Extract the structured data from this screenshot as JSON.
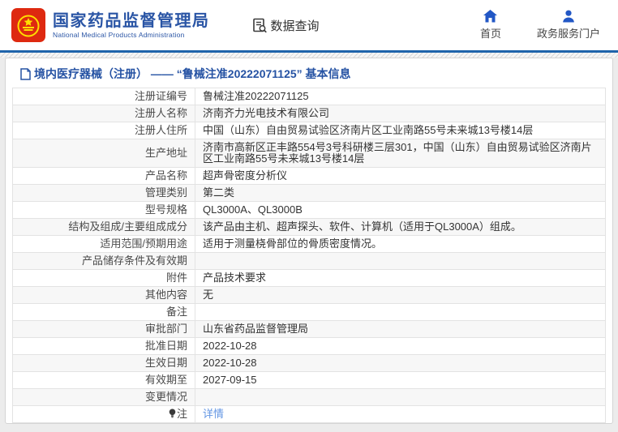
{
  "header": {
    "agency_name_cn": "国家药品监督管理局",
    "agency_name_en": "National Medical Products Administration",
    "data_query_label": "数据查询",
    "home_label": "首页",
    "portal_label": "政务服务门户"
  },
  "breadcrumb": {
    "text": "境内医疗器械（注册） —— “鲁械注准20222071125” 基本信息"
  },
  "table": {
    "rows": [
      {
        "label": "注册证编号",
        "value": "鲁械注准20222071125"
      },
      {
        "label": "注册人名称",
        "value": "济南齐力光电技术有限公司"
      },
      {
        "label": "注册人住所",
        "value": "中国（山东）自由贸易试验区济南片区工业南路55号未来城13号楼14层"
      },
      {
        "label": "生产地址",
        "value": "济南市高新区正丰路554号3号科研楼三层301，中国（山东）自由贸易试验区济南片区工业南路55号未来城13号楼14层"
      },
      {
        "label": "产品名称",
        "value": "超声骨密度分析仪"
      },
      {
        "label": "管理类别",
        "value": "第二类"
      },
      {
        "label": "型号规格",
        "value": "QL3000A、QL3000B"
      },
      {
        "label": "结构及组成/主要组成成分",
        "value": "该产品由主机、超声探头、软件、计算机（适用于QL3000A）组成。"
      },
      {
        "label": "适用范围/预期用途",
        "value": "适用于测量桡骨部位的骨质密度情况。"
      },
      {
        "label": "产品储存条件及有效期",
        "value": ""
      },
      {
        "label": "附件",
        "value": "产品技术要求"
      },
      {
        "label": "其他内容",
        "value": "无"
      },
      {
        "label": "备注",
        "value": ""
      },
      {
        "label": "审批部门",
        "value": "山东省药品监督管理局"
      },
      {
        "label": "批准日期",
        "value": "2022-10-28"
      },
      {
        "label": "生效日期",
        "value": "2022-10-28"
      },
      {
        "label": "有效期至",
        "value": "2027-09-15"
      },
      {
        "label": "变更情况",
        "value": ""
      },
      {
        "label": "注",
        "value": "详情",
        "link": true,
        "icon": "bulb"
      }
    ]
  },
  "colors": {
    "accent_blue": "#2a55a5",
    "divider_blue": "#1f64ab",
    "icon_blue": "#2257c5",
    "link_blue": "#6295e3",
    "logo_red": "#de2910",
    "logo_gold": "#ffde00",
    "row_alt_bg": "#f7f7f7"
  }
}
